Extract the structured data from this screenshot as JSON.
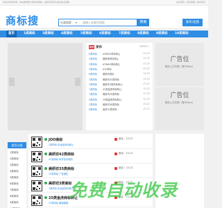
{
  "topbar": {
    "notice": "欢迎访问商标搜！本站收录各分类商标网站，最新商标转让信息欢迎查看",
    "links": "设为首页 | 添加收藏 | 联系我们"
  },
  "header": {
    "logo": "商标搜",
    "search_category": "分类搜索",
    "search_caret": "▾",
    "search_placeholder": "请输入关键字搜索",
    "search_button": "搜索",
    "post_button": "发布/出售"
  },
  "nav": {
    "items": [
      "首页",
      "1类商标",
      "3类商标",
      "4类商标",
      "5类商标",
      "6类商标",
      "7类商标",
      "8类商标",
      "9类商标",
      "10类商标"
    ]
  },
  "slider": {
    "prev": "‹",
    "next": "›"
  },
  "list": {
    "tag": "最新",
    "title": "发布",
    "more": "MORE +",
    "rows": [
      {
        "cat": "6类商标",
        "name": "XXMAG商标转让",
        "date": "15-22"
      },
      {
        "cat": "4类商标",
        "name": "钢铁侠商标转让",
        "date": "15-22"
      },
      {
        "cat": "2类商标",
        "name": "ATWAG商标转让",
        "date": "15-22"
      },
      {
        "cat": "5类商标",
        "name": "JOO商标",
        "date": "15-22"
      },
      {
        "cat": "8类商标",
        "name": "美妍坊商标",
        "date": "15-22"
      },
      {
        "cat": "3类商标",
        "name": "美妍坊42类商标",
        "date": "15-22"
      },
      {
        "cat": "5类商标",
        "name": "美妍坊3类商标转让",
        "date": "15-22"
      },
      {
        "cat": "1类商标",
        "name": "42类金虎商标转让",
        "date": "15-22"
      },
      {
        "cat": "7类商标",
        "name": "美妍坊28类商标",
        "date": "15-22"
      },
      {
        "cat": "9类商标",
        "name": "29类金虎商标转让",
        "date": "15-22"
      },
      {
        "cat": "3类商标",
        "name": "美妍坊38类商标",
        "date": "15-22"
      },
      {
        "cat": "6类商标",
        "name": "金虎32类商标",
        "date": "15-22"
      }
    ]
  },
  "ads": [
    {
      "big": "广告位",
      "small": "首页上方右侧（宽300px）"
    },
    {
      "big": "广告位",
      "small": "首页上方右侧（宽300px）"
    }
  ],
  "sidebar": {
    "head": "首页分类",
    "items": [
      "1类商标",
      "2类商标",
      "3类商标",
      "4类商标",
      "5类商标",
      "6类商标",
      "7类商标",
      "8类商标",
      "9类商标",
      "10类商标"
    ]
  },
  "feed": [
    {
      "name": "JOO商标",
      "sub": "3类商标 化妆品商标转让",
      "price": "面议 · 15-22"
    },
    {
      "name": "美妍坊42类商标",
      "sub": "42类商标 科学技术服务",
      "price": "面议 · 15-22"
    },
    {
      "name": "美妍坊35类商标",
      "sub": "35类商标 广告销售",
      "price": "面议 · 15-22"
    },
    {
      "name": "美妍坊3类商标",
      "sub": "3类商标 化妆品商标转让",
      "price": "面议 · 15-22"
    },
    {
      "name": "25类金虎商标转让",
      "sub": "25类商标 服装鞋帽",
      "price": "面议 · 15-22"
    }
  ],
  "watermark": "免费自动收录",
  "colors": {
    "accent": "#2f8de4",
    "hot": "#e03535",
    "watermark": "#3cc846"
  }
}
